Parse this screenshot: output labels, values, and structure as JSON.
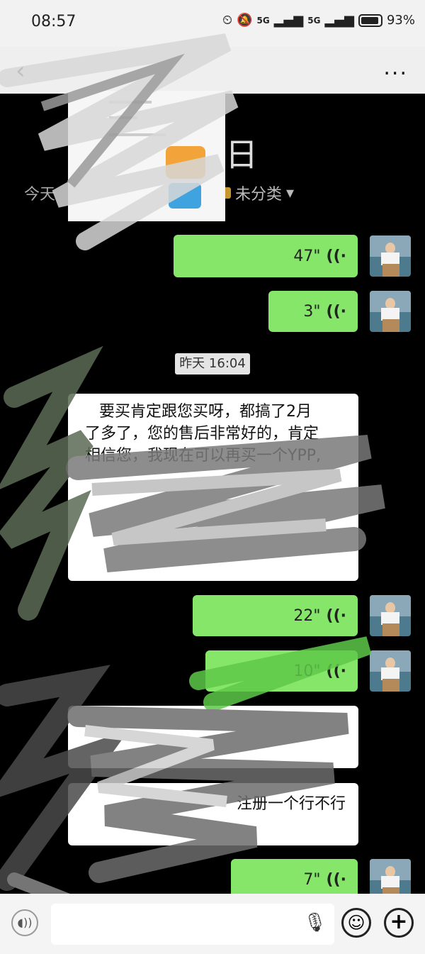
{
  "status_bar": {
    "time": "08:57",
    "network1": "5G",
    "network2": "5G",
    "battery": "93%"
  },
  "nav": {
    "back_icon": "back-icon",
    "more": "..."
  },
  "header": {
    "date_char": "日",
    "today_label": "今天",
    "category": "未分类",
    "category_arrow": "▾"
  },
  "messages": [
    {
      "type": "voice",
      "side": "right",
      "duration": "47\""
    },
    {
      "type": "voice",
      "side": "right",
      "duration": "3\""
    },
    {
      "type": "timestamp",
      "text": "昨天 16:04"
    },
    {
      "type": "text",
      "side": "left",
      "lines": [
        "要买肯定跟您买呀，都搞了2月",
        "了多了，您的售后非常好的，肯定",
        "相信您，我现在可以再买一个YPP,"
      ]
    },
    {
      "type": "voice",
      "side": "right",
      "duration": "22\""
    },
    {
      "type": "voice",
      "side": "right",
      "duration": "10\""
    },
    {
      "type": "text",
      "side": "left",
      "lines": [
        "注册一个行不行"
      ]
    },
    {
      "type": "voice",
      "side": "right",
      "duration": "7\""
    }
  ],
  "input_bar": {
    "placeholder": ""
  },
  "colors": {
    "bubble_green": "#86e66a",
    "bubble_white": "#ffffff",
    "background": "#000000"
  }
}
